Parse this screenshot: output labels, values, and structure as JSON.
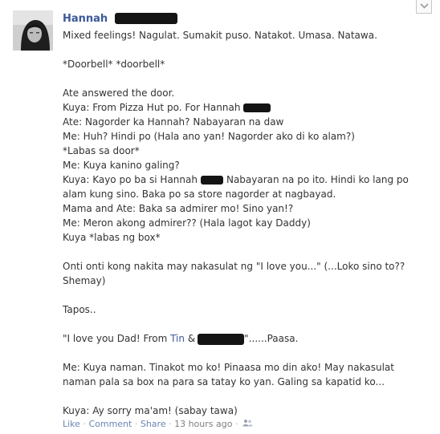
{
  "post": {
    "author_name": "Hannah",
    "menu_icon": "chevron-down-icon",
    "lines": {
      "l1": "Mixed feelings! Nagulat. Sumakit puso. Natakot. Umasa. Natawa.",
      "l2": "*Doorbell* *doorbell*",
      "l3": "Ate answered the door.",
      "l4": "Kuya: From Pizza Hut po. For Hannah",
      "l5": "Ate: Nagorder ka Hannah? Nabayaran na daw",
      "l6": "Me: Huh? Hindi po (Hala ano yan! Nagorder ako di ko alam?)",
      "l7": "*Labas sa door*",
      "l8": "Me: Kuya kanino galing?",
      "l9a": "Kuya: Kayo po ba si Hannah",
      "l9b": "Nabayaran na po ito. Hindi ko lang po",
      "l10": "alam kung sino. Baka po sa store nagorder at nagbayad.",
      "l11": "Mama and Ate: Baka sa admirer mo! Sino yan!?",
      "l12": "Me: Meron akong admirer?? (Hala lagot kay Daddy)",
      "l13": "Kuya *labas ng box*",
      "l14": "Onti onti kong nakita may nakasulat ng \"I love you...\" (...Loko sino to??",
      "l15": "Shemay)",
      "l16": "Tapos..",
      "l17a": "\"I love you Dad! From ",
      "l17_link": "Tin",
      "l17b": " &",
      "l17c": "\"......Paasa.",
      "l18": "Me: Kuya naman. Tinakot mo ko! Pinaasa mo din ako! May nakasulat",
      "l19": "naman pala sa box na para sa tatay ko yan. Galing sa kapatid ko...",
      "l20": "Kuya: Ay sorry ma'am! (sabay tawa)"
    }
  },
  "footer": {
    "like": "Like",
    "comment": "Comment",
    "share": "Share",
    "separator": "·",
    "timestamp": "13 hours ago",
    "privacy_icon": "friends-icon"
  },
  "colors": {
    "link": "#3b5998",
    "text": "#333333",
    "meta": "#7f7f7f",
    "redaction": "#141414"
  }
}
